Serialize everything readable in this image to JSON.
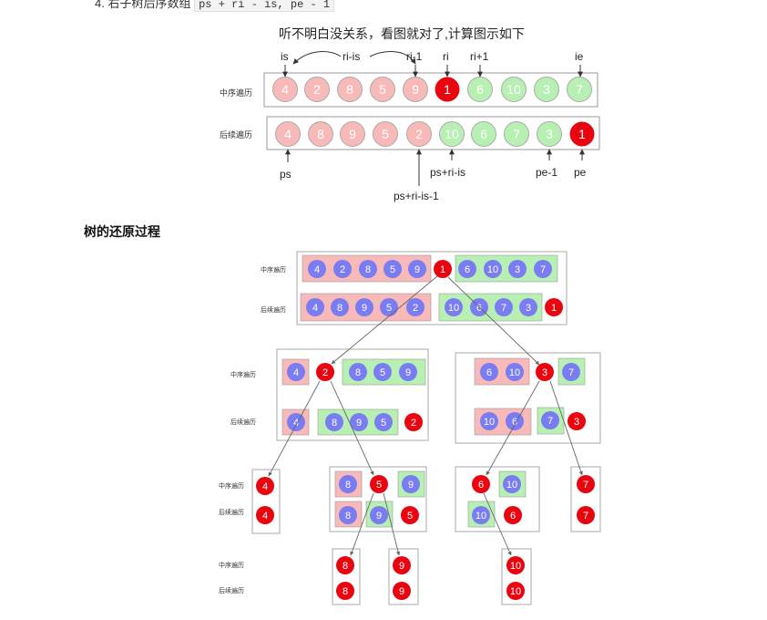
{
  "top_line": {
    "prefix": "4. 右子树后序数组",
    "code": "ps + ri - is, pe - 1"
  },
  "section_heading": "树的还原过程",
  "diagram1": {
    "caption": "听不明白没关系，看图就对了,计算图示如下",
    "inorder_label": "中序遍历",
    "postorder_label": "后续遍历",
    "inorder": [
      "4",
      "2",
      "8",
      "5",
      "9",
      "1",
      "6",
      "10",
      "3",
      "7"
    ],
    "postorder": [
      "4",
      "8",
      "9",
      "5",
      "2",
      "10",
      "6",
      "7",
      "3",
      "1"
    ],
    "top_labels": [
      "is",
      "ri-is",
      "ri-1",
      "ri",
      "ri+1",
      "ie"
    ],
    "bottom_labels": [
      "ps",
      "ps+ri-is",
      "ps+ri-is-1",
      "pe-1",
      "pe"
    ]
  },
  "diagram2": {
    "inorder_label": "中序遍历",
    "postorder_label": "后续遍历",
    "level0": {
      "in_left": [
        "4",
        "2",
        "8",
        "5",
        "9"
      ],
      "root": "1",
      "in_right": [
        "6",
        "10",
        "3",
        "7"
      ],
      "post_left": [
        "4",
        "8",
        "9",
        "5",
        "2"
      ],
      "post_right": [
        "10",
        "6",
        "7",
        "3"
      ]
    },
    "level1_left": {
      "in_left": [
        "4"
      ],
      "root": "2",
      "in_right": [
        "8",
        "5",
        "9"
      ],
      "post_left": [
        "4"
      ],
      "post_right": [
        "8",
        "9",
        "5"
      ]
    },
    "level1_right": {
      "in_left": [
        "6",
        "10"
      ],
      "root": "3",
      "in_right": [
        "7"
      ],
      "post_left": [
        "10",
        "6"
      ],
      "post_right": [
        "7"
      ]
    },
    "level2": {
      "n4": "4",
      "n5": "5",
      "n8": "8",
      "n9": "9",
      "n6": "6",
      "n10": "10",
      "n7": "7"
    },
    "level3": {
      "n8": "8",
      "n9": "9",
      "n10": "10"
    }
  },
  "colors": {
    "red": "#e8050f",
    "pink_fill": "#f8b9b9",
    "green_fill": "#b8f0b3",
    "purple": "#7a7cf2",
    "box_border": "#aaaaaa"
  }
}
